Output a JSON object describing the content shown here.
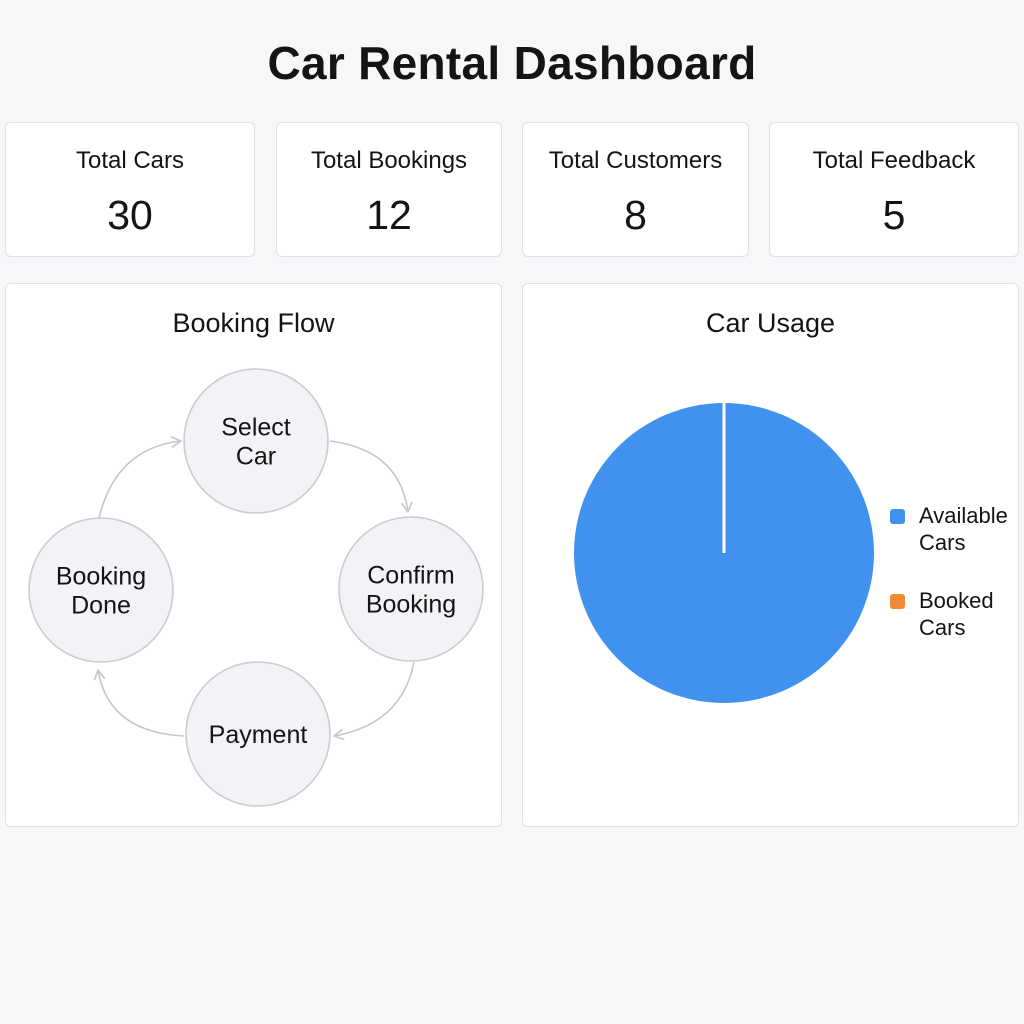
{
  "page": {
    "title": "Car Rental Dashboard"
  },
  "stats": [
    {
      "label": "Total Cars",
      "value": "30"
    },
    {
      "label": "Total Bookings",
      "value": "12"
    },
    {
      "label": "Total Customers",
      "value": "8"
    },
    {
      "label": "Total Feedback",
      "value": "5"
    }
  ],
  "booking_flow": {
    "title": "Booking Flow",
    "steps": [
      {
        "lines": [
          "Select",
          "Car"
        ]
      },
      {
        "lines": [
          "Confirm",
          "Booking"
        ]
      },
      {
        "lines": [
          "Payment"
        ]
      },
      {
        "lines": [
          "Booking",
          "Done"
        ]
      }
    ],
    "colors": {
      "node_fill": "#f2f3f6",
      "node_stroke": "#c9ccd2",
      "arrow": "#c3c6cc"
    }
  },
  "car_usage": {
    "title": "Car Usage",
    "legend": [
      {
        "label_lines": [
          "Available",
          "Cars"
        ],
        "color": "#4192ef"
      },
      {
        "label_lines": [
          "Booked",
          "Cars"
        ],
        "color": "#f38b36"
      }
    ]
  },
  "chart_data": {
    "type": "pie",
    "title": "Car Usage",
    "categories": [
      "Available Cars",
      "Booked Cars"
    ],
    "values": [
      30,
      0
    ],
    "colors": [
      "#4192ef",
      "#f38b36"
    ],
    "legend_position": "right"
  }
}
